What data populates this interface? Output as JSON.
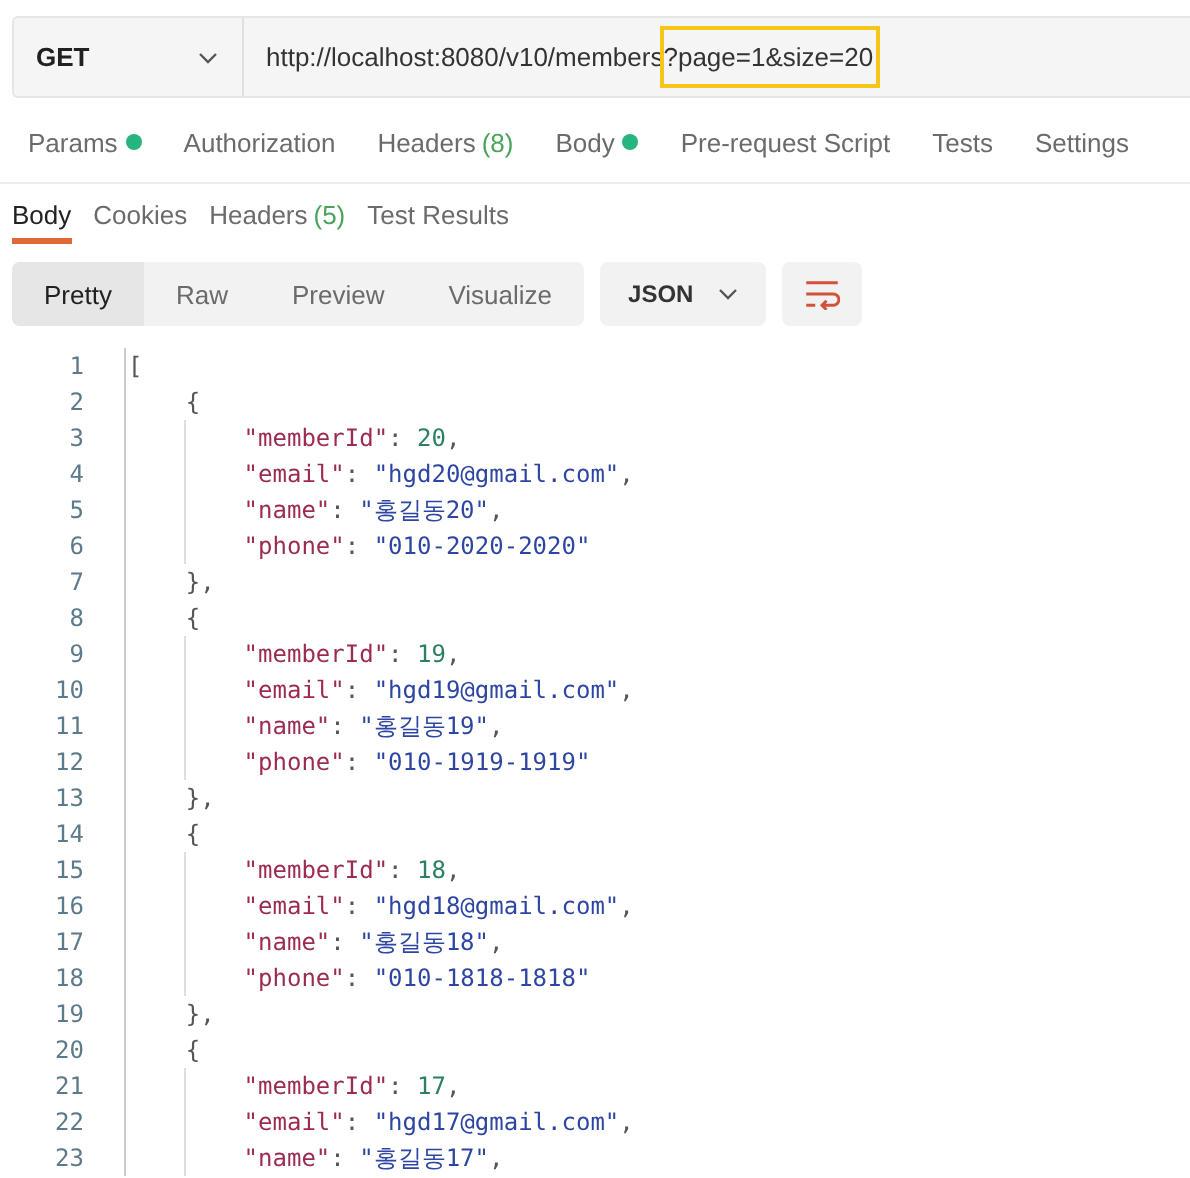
{
  "request": {
    "method": "GET",
    "url": "http://localhost:8080/v10/members",
    "url_highlighted": "?page=1&size=20"
  },
  "request_tabs": [
    {
      "label": "Params",
      "dot": true,
      "selected": false
    },
    {
      "label": "Authorization",
      "dot": false,
      "selected": false
    },
    {
      "label": "Headers",
      "count": "(8)",
      "dot": false,
      "selected": false
    },
    {
      "label": "Body",
      "dot": true,
      "selected": false
    },
    {
      "label": "Pre-request Script",
      "dot": false,
      "selected": false
    },
    {
      "label": "Tests",
      "dot": false,
      "selected": false
    },
    {
      "label": "Settings",
      "dot": false,
      "selected": false
    }
  ],
  "response_tabs": [
    {
      "label": "Body",
      "selected": true
    },
    {
      "label": "Cookies",
      "selected": false
    },
    {
      "label": "Headers",
      "count": "(5)",
      "selected": false
    },
    {
      "label": "Test Results",
      "selected": false
    }
  ],
  "view_modes": [
    {
      "label": "Pretty",
      "selected": true
    },
    {
      "label": "Raw",
      "selected": false
    },
    {
      "label": "Preview",
      "selected": false
    },
    {
      "label": "Visualize",
      "selected": false
    }
  ],
  "format": "JSON",
  "code_lines": [
    {
      "number": "1",
      "text": "["
    },
    {
      "number": "2",
      "text": "    {"
    },
    {
      "number": "3",
      "text": "        \"memberId\": 20,"
    },
    {
      "number": "4",
      "text": "        \"email\": \"hgd20@gmail.com\","
    },
    {
      "number": "5",
      "text": "        \"name\": \"홍길동20\","
    },
    {
      "number": "6",
      "text": "        \"phone\": \"010-2020-2020\""
    },
    {
      "number": "7",
      "text": "    },"
    },
    {
      "number": "8",
      "text": "    {"
    },
    {
      "number": "9",
      "text": "        \"memberId\": 19,"
    },
    {
      "number": "10",
      "text": "        \"email\": \"hgd19@gmail.com\","
    },
    {
      "number": "11",
      "text": "        \"name\": \"홍길동19\","
    },
    {
      "number": "12",
      "text": "        \"phone\": \"010-1919-1919\""
    },
    {
      "number": "13",
      "text": "    },"
    },
    {
      "number": "14",
      "text": "    {"
    },
    {
      "number": "15",
      "text": "        \"memberId\": 18,"
    },
    {
      "number": "16",
      "text": "        \"email\": \"hgd18@gmail.com\","
    },
    {
      "number": "17",
      "text": "        \"name\": \"홍길동18\","
    },
    {
      "number": "18",
      "text": "        \"phone\": \"010-1818-1818\""
    },
    {
      "number": "19",
      "text": "    },"
    },
    {
      "number": "20",
      "text": "    {"
    },
    {
      "number": "21",
      "text": "        \"memberId\": 17,"
    },
    {
      "number": "22",
      "text": "        \"email\": \"hgd17@gmail.com\","
    },
    {
      "number": "23",
      "text": "        \"name\": \"홍길동17\","
    }
  ]
}
